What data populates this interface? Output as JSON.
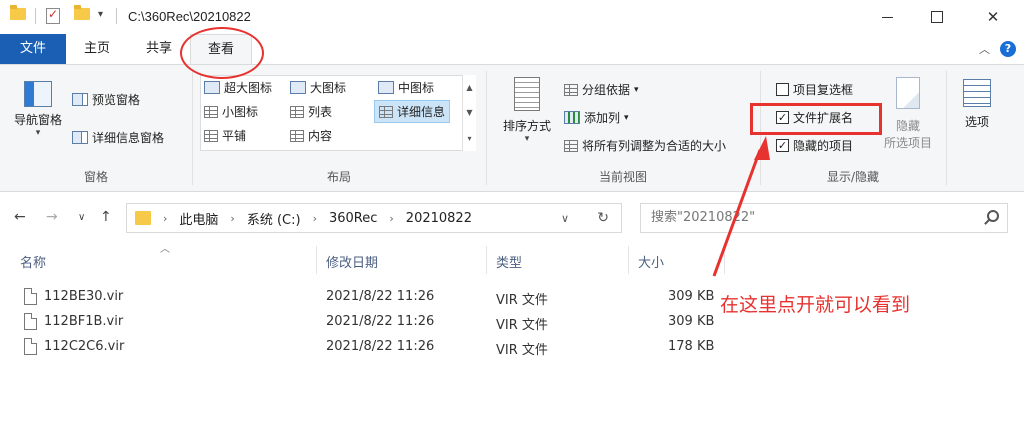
{
  "window": {
    "title": "C:\\360Rec\\20210822",
    "controls": {
      "close": "✕"
    }
  },
  "ribbon_tabs": {
    "file": "文件",
    "home": "主页",
    "share": "共享",
    "view": "查看"
  },
  "ribbon": {
    "panes": {
      "label": "窗格",
      "nav_pane": "导航窗格",
      "preview_pane": "预览窗格",
      "details_pane": "详细信息窗格"
    },
    "layout": {
      "label": "布局",
      "items": [
        "超大图标",
        "大图标",
        "中图标",
        "小图标",
        "列表",
        "详细信息",
        "平铺",
        "内容"
      ]
    },
    "current_view": {
      "label": "当前视图",
      "sort_by": "排序方式",
      "group_by": "分组依据",
      "add_column": "添加列",
      "fit_columns": "将所有列调整为合适的大小"
    },
    "show_hide": {
      "label": "显示/隐藏",
      "item_checkboxes": "项目复选框",
      "file_extensions": "文件扩展名",
      "hidden_items": "隐藏的项目",
      "hide_selected_1": "隐藏",
      "hide_selected_2": "所选项目",
      "checks": {
        "item_checkboxes": false,
        "file_extensions": true,
        "hidden_items": true
      }
    },
    "options": "选项"
  },
  "address": {
    "crumbs": [
      "此电脑",
      "系统 (C:)",
      "360Rec",
      "20210822"
    ],
    "search_placeholder": "搜索\"20210822\""
  },
  "file_list": {
    "columns": [
      "名称",
      "修改日期",
      "类型",
      "大小"
    ],
    "rows": [
      {
        "name": "112BE30.vir",
        "date": "2021/8/22 11:26",
        "type": "VIR 文件",
        "size": "309 KB"
      },
      {
        "name": "112BF1B.vir",
        "date": "2021/8/22 11:26",
        "type": "VIR 文件",
        "size": "309 KB"
      },
      {
        "name": "112C2C6.vir",
        "date": "2021/8/22 11:26",
        "type": "VIR 文件",
        "size": "178 KB"
      }
    ]
  },
  "annotation": {
    "text": "在这里点开就可以看到",
    "color": "#e8322f"
  }
}
